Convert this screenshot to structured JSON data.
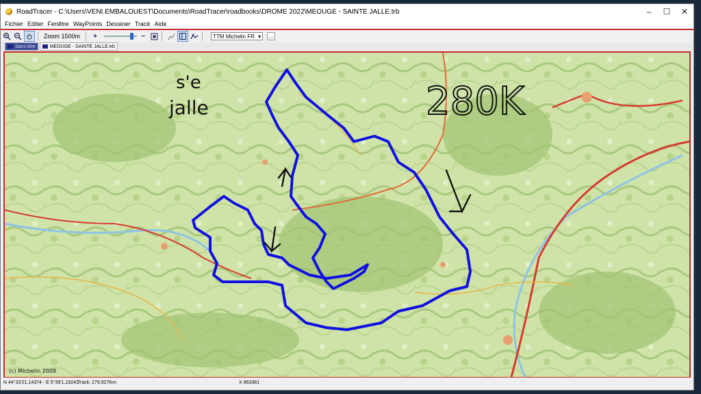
{
  "window": {
    "title": "RoadTracer - C:\\Users\\VENI.EMBALOUEST\\Documents\\RoadTracer\\roadbooks\\DROME 2022\\MEOUGE - SAINTE JALLE.trb",
    "controls": [
      "–",
      "☐",
      "✕"
    ]
  },
  "menu": [
    "Fichier",
    "Editer",
    "Fenêtre",
    "WayPoints",
    "Dessiner",
    "Tracé",
    "Aide"
  ],
  "toolbar": {
    "zoom_label": "Zoom 1500m",
    "zoom_in": "+",
    "zoom_out": "−",
    "map_select": "TTM Michelin FR",
    "map_select_arrow": "▾",
    "extra_button": "…",
    "icons": [
      "zoom-in-icon",
      "zoom-out-icon",
      "hand-icon",
      "fit-icon",
      "route-icon",
      "panel-icon",
      "trace-icon"
    ]
  },
  "tabs": [
    {
      "label": "Sans titre",
      "active": true
    },
    {
      "label": "MEOUGE - SAINTE JALLE.trb",
      "active": false
    }
  ],
  "map": {
    "copyright": "(c) Michelin 2009",
    "route_color": "#1010e0",
    "handwriting": {
      "place_line1": "s'e",
      "place_line2": "jalle",
      "distance": "280K",
      "arrow_up": "↑"
    }
  },
  "status": {
    "coords": "N 44°33'21,14374 - E 5°39'1,19241",
    "track": "Track: 279,927Km",
    "x": "X 863381"
  }
}
